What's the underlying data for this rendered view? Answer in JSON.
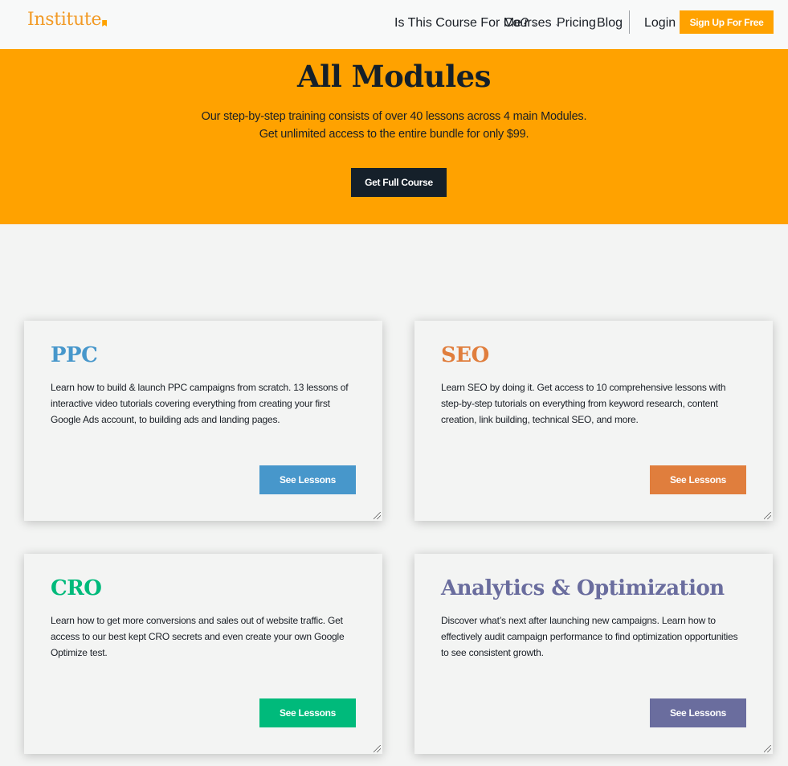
{
  "header": {
    "logo_text": "Institute",
    "nav": [
      {
        "label": "Is This Course For Me?",
        "has_dropdown": true
      },
      {
        "label": "Courses",
        "has_dropdown": true
      },
      {
        "label": "Pricing",
        "has_dropdown": false
      },
      {
        "label": "Blog",
        "has_dropdown": false
      }
    ],
    "login_label": "Login",
    "signup_label": "Sign Up For Free",
    "dropdown_glyph": "⌄"
  },
  "hero": {
    "title": "All Modules",
    "subtitle_line1": "Our step-by-step training consists of over 40 lessons across 4 main Modules.",
    "subtitle_line2": "Get unlimited access to the entire bundle for only $99.",
    "cta_label": "Get Full Course"
  },
  "modules": [
    {
      "title": "PPC",
      "color": "#4797cb",
      "description": "Learn how to build & launch PPC campaigns from scratch. 13 lessons of interactive video tutorials covering everything from creating your first Google Ads account, to building ads and landing pages.",
      "button_label": "See Lessons"
    },
    {
      "title": "SEO",
      "color": "#e07e3d",
      "description": "Learn SEO by doing it. Get access to 10 comprehensive lessons with step-by-step tutorials on everything from keyword research, content creation, link building, technical SEO, and more.",
      "button_label": "See Lessons"
    },
    {
      "title": "CRO",
      "color": "#00ba7b",
      "description": "Learn how to get more conversions and sales out of website traffic. Get access to our best kept CRO secrets and even create your own Google Optimize test.",
      "button_label": "See Lessons"
    },
    {
      "title": "Analytics & Optimization",
      "color": "#6a6d9e",
      "description": "Discover what’s next after launching new campaigns. Learn how to effectively audit campaign performance to find optimization opportunities to see consistent growth.",
      "button_label": "See Lessons"
    }
  ],
  "colors": {
    "brand_orange": "#ffa200",
    "dark": "#15202a",
    "background": "#f3f4f3"
  }
}
